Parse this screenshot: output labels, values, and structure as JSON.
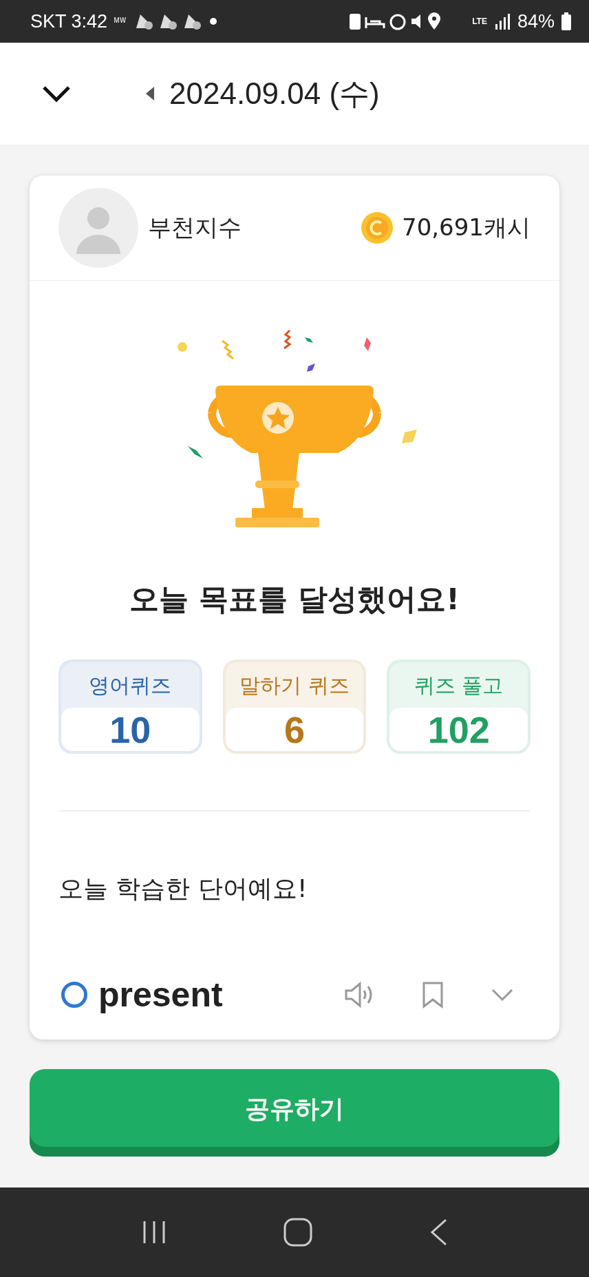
{
  "status_bar": {
    "carrier_time": "SKT 3:42",
    "tag": "ᴹᵂ",
    "network": "LTE",
    "battery": "84%"
  },
  "header": {
    "date": "2024.09.04 (수)"
  },
  "profile": {
    "name": "부천지수",
    "cash": "70,691캐시"
  },
  "title": "오늘 목표를 달성했어요!",
  "stats": [
    {
      "label": "영어퀴즈",
      "value": "10",
      "color": "#2a64a8"
    },
    {
      "label": "말하기 퀴즈",
      "value": "6",
      "color": "#b6761a"
    },
    {
      "label": "퀴즈 풀고",
      "value": "102",
      "color": "#21a062"
    }
  ],
  "words_heading": "오늘 학습한 단어예요!",
  "words": [
    {
      "word": "present",
      "checked": false
    }
  ],
  "share_button": "공유하기"
}
